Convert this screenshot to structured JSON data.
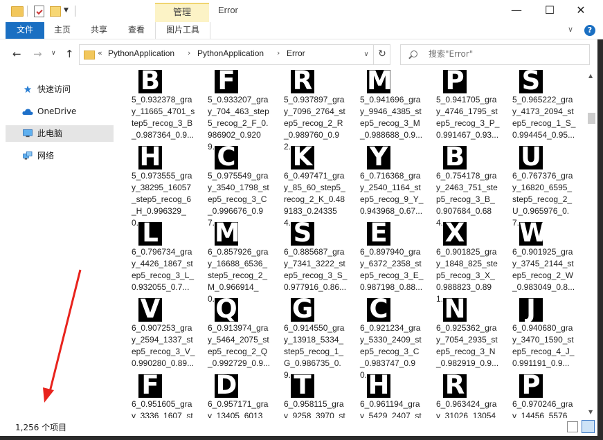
{
  "window": {
    "title": "Error",
    "manage_tab": "管理",
    "controls": {
      "minimize": "—",
      "maximize": "☐",
      "close": "✕"
    }
  },
  "ribbon": {
    "tabs": [
      "文件",
      "主页",
      "共享",
      "查看",
      "图片工具"
    ],
    "help": "?"
  },
  "address": {
    "prefix": "«",
    "crumbs": [
      "PythonApplication",
      "PythonApplication",
      "Error"
    ],
    "separator": "›"
  },
  "search": {
    "placeholder": "搜索\"Error\""
  },
  "sidebar": {
    "items": [
      {
        "label": "快速访问",
        "icon": "star-icon"
      },
      {
        "label": "OneDrive",
        "icon": "cloud-icon"
      },
      {
        "label": "此电脑",
        "icon": "computer-icon"
      },
      {
        "label": "网络",
        "icon": "network-icon"
      }
    ]
  },
  "files": [
    {
      "glyph": "B",
      "name": "5_0.932378_gray_11665_4701_step5_recog_3_B_0.987364_0.9..."
    },
    {
      "glyph": "F",
      "name": "5_0.933207_gray_704_463_step5_recog_2_F_0.986902_0.9209..."
    },
    {
      "glyph": "R",
      "name": "5_0.937897_gray_7096_2764_step5_recog_2_R_0.989760_0.92..."
    },
    {
      "glyph": "M",
      "name": "5_0.941696_gray_9946_4385_step5_recog_3_M_0.988688_0.9..."
    },
    {
      "glyph": "P",
      "name": "5_0.941705_gray_4746_1795_step5_recog_3_P_0.991467_0.93..."
    },
    {
      "glyph": "S",
      "name": "5_0.965222_gray_4173_2094_step5_recog_1_S_0.994454_0.95..."
    },
    {
      "glyph": "H",
      "name": "5_0.973555_gray_38295_16057_step5_recog_6_H_0.996329_0...."
    },
    {
      "glyph": "C",
      "name": "5_0.975549_gray_3540_1798_step5_recog_3_C_0.996676_0.97..."
    },
    {
      "glyph": "K",
      "name": "6_0.497471_gray_85_60_step5_recog_2_K_0.489183_0.243354...."
    },
    {
      "glyph": "Y",
      "name": "6_0.716368_gray_2540_1164_step5_recog_9_Y_0.943968_0.67..."
    },
    {
      "glyph": "B",
      "name": "6_0.754178_gray_2463_751_step5_recog_3_B_0.907684_0.684..."
    },
    {
      "glyph": "U",
      "name": "6_0.767376_gray_16820_6595_step5_recog_2_U_0.965976_0.7..."
    },
    {
      "glyph": "L",
      "name": "6_0.796734_gray_4426_1867_step5_recog_3_L_0.932055_0.7..."
    },
    {
      "glyph": "M",
      "name": "6_0.857926_gray_16688_6536_step5_recog_2_M_0.966914_0...."
    },
    {
      "glyph": "S",
      "name": "6_0.885687_gray_7341_3222_step5_recog_3_S_0.977916_0.86..."
    },
    {
      "glyph": "E",
      "name": "6_0.897940_gray_6372_2358_step5_recog_3_E_0.987198_0.88..."
    },
    {
      "glyph": "X",
      "name": "6_0.901825_gray_1848_825_step5_recog_3_X_0.988823_0.891..."
    },
    {
      "glyph": "W",
      "name": "6_0.901925_gray_3745_2144_step5_recog_2_W_0.983049_0.8..."
    },
    {
      "glyph": "V",
      "name": "6_0.907253_gray_2594_1337_step5_recog_3_V_0.990280_0.89..."
    },
    {
      "glyph": "Q",
      "name": "6_0.913974_gray_5464_2075_step5_recog_2_Q_0.992729_0.9..."
    },
    {
      "glyph": "G",
      "name": "6_0.914550_gray_13918_5334_step5_recog_1_G_0.986735_0.9..."
    },
    {
      "glyph": "C",
      "name": "6_0.921234_gray_5330_2409_step5_recog_3_C_0.983747_0.90..."
    },
    {
      "glyph": "N",
      "name": "6_0.925362_gray_7054_2935_step5_recog_3_N_0.982919_0.9..."
    },
    {
      "glyph": "J",
      "name": "6_0.940680_gray_3470_1590_step5_recog_4_J_0.991191_0.9..."
    },
    {
      "glyph": "F",
      "name": "6_0.951605_gray_3336_1607_st"
    },
    {
      "glyph": "D",
      "name": "6_0.957171_gray_13405_6013_s"
    },
    {
      "glyph": "T",
      "name": "6_0.958115_gray_9258_3970_st"
    },
    {
      "glyph": "H",
      "name": "6_0.961194_gray_5429_2407_st"
    },
    {
      "glyph": "R",
      "name": "6_0.963424_gray_31026_13054_"
    },
    {
      "glyph": "P",
      "name": "6_0.970246_gray_14456_5576_s"
    }
  ],
  "status": {
    "count": "1,256 个项目"
  },
  "colors": {
    "accent": "#1a6fc2",
    "manage_tab": "#fcf3c6",
    "annotation_arrow": "#e8231d"
  }
}
